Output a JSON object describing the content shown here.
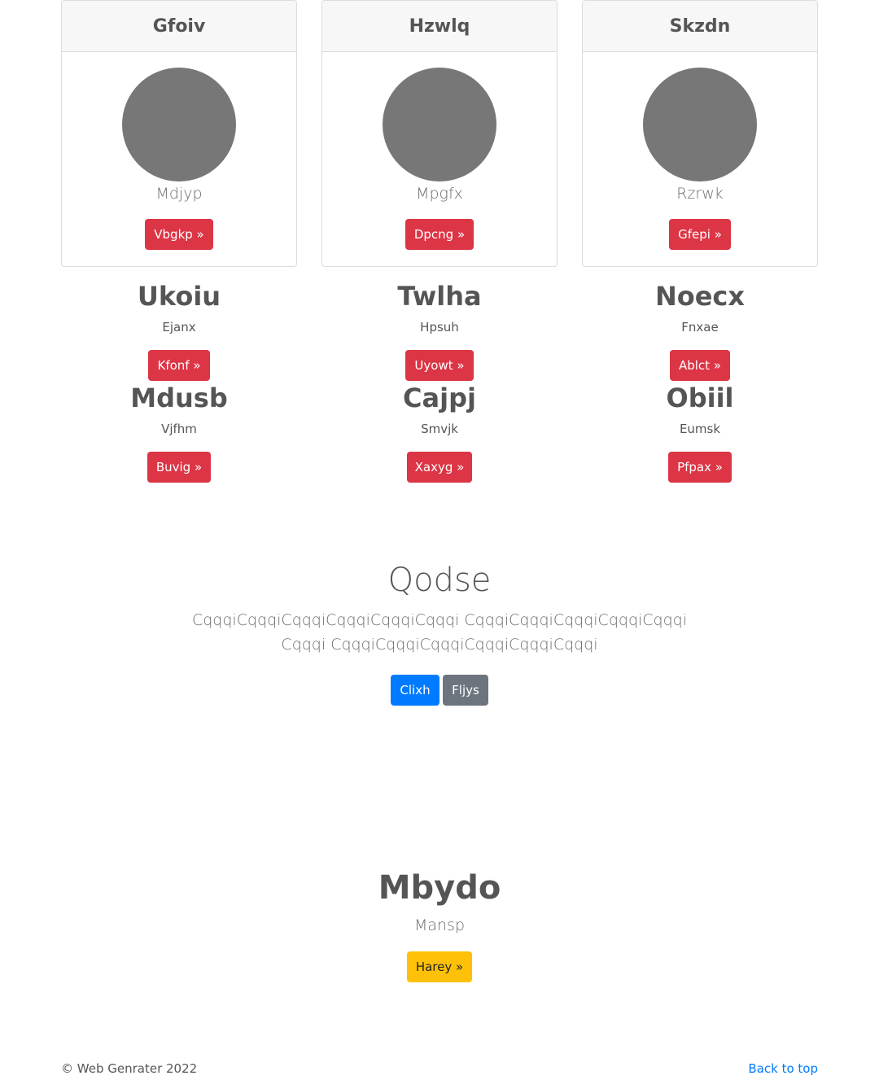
{
  "cards": [
    {
      "header": "Gfoiv",
      "sub": "Mdjyp",
      "button": "Vbgkp »"
    },
    {
      "header": "Hzwlq",
      "sub": "Mpgfx",
      "button": "Dpcng »"
    },
    {
      "header": "Skzdn",
      "sub": "Rzrwk",
      "button": "Gfepi »"
    }
  ],
  "row1": [
    {
      "title": "Ukoiu",
      "sub": "Ejanx",
      "button": "Kfonf »"
    },
    {
      "title": "Twlha",
      "sub": "Hpsuh",
      "button": "Uyowt »"
    },
    {
      "title": "Noecx",
      "sub": "Fnxae",
      "button": "Ablct »"
    }
  ],
  "row2": [
    {
      "title": "Mdusb",
      "sub": "Vjfhm",
      "button": "Buvig »"
    },
    {
      "title": "Cajpj",
      "sub": "Smvjk",
      "button": "Xaxyg »"
    },
    {
      "title": "Obiil",
      "sub": "Eumsk",
      "button": "Pfpax »"
    }
  ],
  "hero": {
    "title": "Qodse",
    "text": "CqqqiCqqqiCqqqiCqqqiCqqqiCqqqi CqqqiCqqqiCqqqiCqqqiCqqqiCqqqi CqqqiCqqqiCqqqiCqqqiCqqqiCqqqi",
    "primary_button": "Clixh",
    "secondary_button": "Fljys"
  },
  "feature": {
    "title": "Mbydo",
    "sub": "Mansp",
    "button": "Harey »"
  },
  "footer": {
    "copyright": "© Web Genrater 2022",
    "back_to_top": "Back to top"
  },
  "colors": {
    "danger": "#dc3545",
    "primary": "#007bff",
    "secondary": "#6c757d",
    "warning": "#ffc107"
  }
}
